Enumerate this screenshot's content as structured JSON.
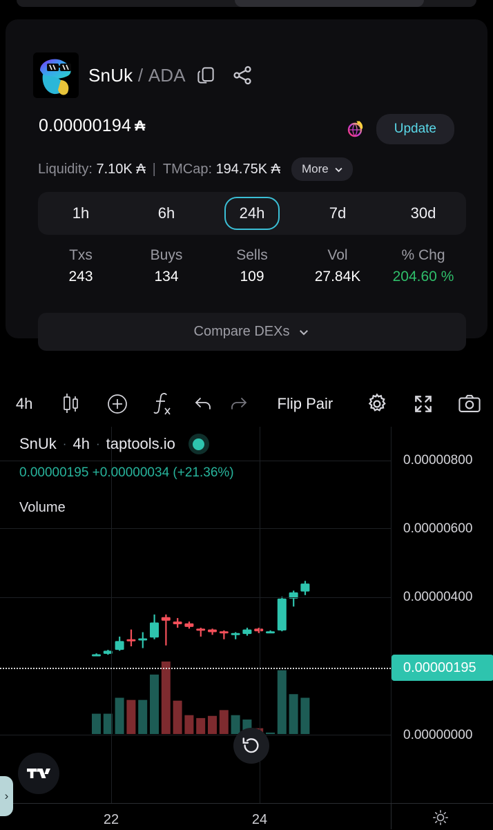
{
  "top_strip": {
    "present": true
  },
  "token": {
    "base": "SnUk",
    "separator": "/",
    "quote": "ADA",
    "logo_alt": "snuk-token-logo",
    "copy_icon": "copy-icon",
    "share_icon": "share-icon"
  },
  "price": {
    "value": "0.00000194",
    "currency_glyph": "₳",
    "update_label": "Update",
    "refresh_icon": "refresh-globe-icon"
  },
  "metrics": {
    "liquidity_label": "Liquidity:",
    "liquidity_value": "7.10K",
    "liquidity_glyph": "₳",
    "divider": "|",
    "tmcap_label": "TMCap:",
    "tmcap_value": "194.75K",
    "tmcap_glyph": "₳",
    "more_label": "More",
    "more_icon": "chevron-down-icon"
  },
  "timeframes": {
    "options": [
      "1h",
      "6h",
      "24h",
      "7d",
      "30d"
    ],
    "active": "24h"
  },
  "stats": [
    {
      "key": "Txs",
      "value": "243",
      "positive": false
    },
    {
      "key": "Buys",
      "value": "134",
      "positive": false
    },
    {
      "key": "Sells",
      "value": "109",
      "positive": false
    },
    {
      "key": "Vol",
      "value": "27.84K",
      "positive": false
    },
    {
      "key": "% Chg",
      "value": "204.60 %",
      "positive": true
    }
  ],
  "compare": {
    "label": "Compare DEXs",
    "icon": "chevron-down-icon"
  },
  "chart_toolbar": {
    "interval": "4h",
    "candle_icon": "candlestick-icon",
    "plus_icon": "add-indicator-icon",
    "fx_icon": "fx-indicator-icon",
    "undo_icon": "undo-icon",
    "redo_icon": "redo-icon",
    "flip_label": "Flip Pair",
    "gear_icon": "gear-icon",
    "fullscreen_icon": "fullscreen-icon",
    "camera_icon": "camera-icon"
  },
  "chart_legend": {
    "symbol": "SnUk",
    "interval": "4h",
    "source": "taptools.io",
    "dot1": "·",
    "dot2": "·",
    "status_icon": "status-dot-icon",
    "ohlc": "0.00000195  +0.00000034 (+21.36%)",
    "volume_label": "Volume"
  },
  "footer": {
    "reset_icon": "reset-chart-icon",
    "tradingview_icon": "tradingview-logo-icon",
    "side_handle_icon": "chevron-right-icon",
    "sun_icon": "theme-toggle-icon"
  },
  "colors": {
    "accent_teal": "#2ec4ae",
    "accent_cyan": "#3bbfd6",
    "positive_green": "#2fbe6a",
    "bull_candle": "#2ec4ae",
    "bear_candle": "#f4505a",
    "bull_volume": "#1d5c55",
    "bear_volume": "#7e2b2f",
    "card_bg": "#0e0e11",
    "pill_bg": "#18181c",
    "page_bg": "#000000"
  },
  "chart_data": {
    "type": "candlestick",
    "title": "SnUk · 4h · taptools.io",
    "source": "taptools.io",
    "interval": "4h",
    "xlabel": "",
    "ylabel": "",
    "grid": true,
    "legend_position": "top-left",
    "price_axis_side": "right",
    "price_ticks": [
      "0.00000800",
      "0.00000600",
      "0.00000400",
      "0.00000000"
    ],
    "price_tick_values": [
      8e-06,
      6e-06,
      4e-06,
      0.0
    ],
    "current_price_label": "0.00000195",
    "current_price": 1.95e-06,
    "ylim": [
      0.0,
      9.1e-06
    ],
    "x_ticks": [
      "22",
      "24"
    ],
    "x_tick_positions": [
      160,
      375
    ],
    "price_change_abs": "+0.00000034",
    "price_change_pct": "+21.36%",
    "volume_panel": {
      "label": "Volume",
      "ylim": [
        0,
        1.0
      ]
    },
    "candles": [
      {
        "i": 0,
        "open": 0.3,
        "high": 0.34,
        "low": 0.28,
        "close": 0.32,
        "dir": "up",
        "vol": 0.28
      },
      {
        "i": 1,
        "open": 0.33,
        "high": 0.42,
        "low": 0.31,
        "close": 0.4,
        "dir": "up",
        "vol": 0.28
      },
      {
        "i": 2,
        "open": 0.42,
        "high": 0.72,
        "low": 0.4,
        "close": 0.62,
        "dir": "up",
        "vol": 0.5
      },
      {
        "i": 3,
        "open": 0.66,
        "high": 0.88,
        "low": 0.5,
        "close": 0.62,
        "dir": "down",
        "vol": 0.47
      },
      {
        "i": 4,
        "open": 0.64,
        "high": 0.82,
        "low": 0.46,
        "close": 0.68,
        "dir": "up",
        "vol": 0.47
      },
      {
        "i": 5,
        "open": 0.7,
        "high": 1.22,
        "low": 0.66,
        "close": 1.04,
        "dir": "up",
        "vol": 0.82
      },
      {
        "i": 6,
        "open": 1.16,
        "high": 1.22,
        "low": 0.52,
        "close": 1.08,
        "dir": "down",
        "vol": 1.0
      },
      {
        "i": 7,
        "open": 1.06,
        "high": 1.14,
        "low": 0.92,
        "close": 1.0,
        "dir": "down",
        "vol": 0.46
      },
      {
        "i": 8,
        "open": 1.02,
        "high": 1.06,
        "low": 0.9,
        "close": 0.94,
        "dir": "down",
        "vol": 0.26
      },
      {
        "i": 9,
        "open": 0.9,
        "high": 0.92,
        "low": 0.72,
        "close": 0.86,
        "dir": "down",
        "vol": 0.22
      },
      {
        "i": 10,
        "open": 0.88,
        "high": 0.9,
        "low": 0.76,
        "close": 0.82,
        "dir": "down",
        "vol": 0.25
      },
      {
        "i": 11,
        "open": 0.84,
        "high": 0.86,
        "low": 0.66,
        "close": 0.8,
        "dir": "down",
        "vol": 0.33
      },
      {
        "i": 12,
        "open": 0.8,
        "high": 0.82,
        "low": 0.66,
        "close": 0.78,
        "dir": "up",
        "vol": 0.26
      },
      {
        "i": 13,
        "open": 0.78,
        "high": 0.92,
        "low": 0.74,
        "close": 0.88,
        "dir": "up",
        "vol": 0.2
      },
      {
        "i": 14,
        "open": 0.9,
        "high": 0.92,
        "low": 0.8,
        "close": 0.84,
        "dir": "down",
        "vol": 0.08
      },
      {
        "i": 15,
        "open": 0.84,
        "high": 0.86,
        "low": 0.82,
        "close": 0.84,
        "dir": "up",
        "vol": 0.02
      },
      {
        "i": 16,
        "open": 0.86,
        "high": 1.62,
        "low": 0.84,
        "close": 1.58,
        "dir": "up",
        "vol": 0.88
      },
      {
        "i": 17,
        "open": 1.58,
        "high": 1.76,
        "low": 1.4,
        "close": 1.72,
        "dir": "up",
        "vol": 0.55
      },
      {
        "i": 18,
        "open": 1.74,
        "high": 1.98,
        "low": 1.66,
        "close": 1.92,
        "dir": "up",
        "vol": 0.5
      }
    ]
  }
}
